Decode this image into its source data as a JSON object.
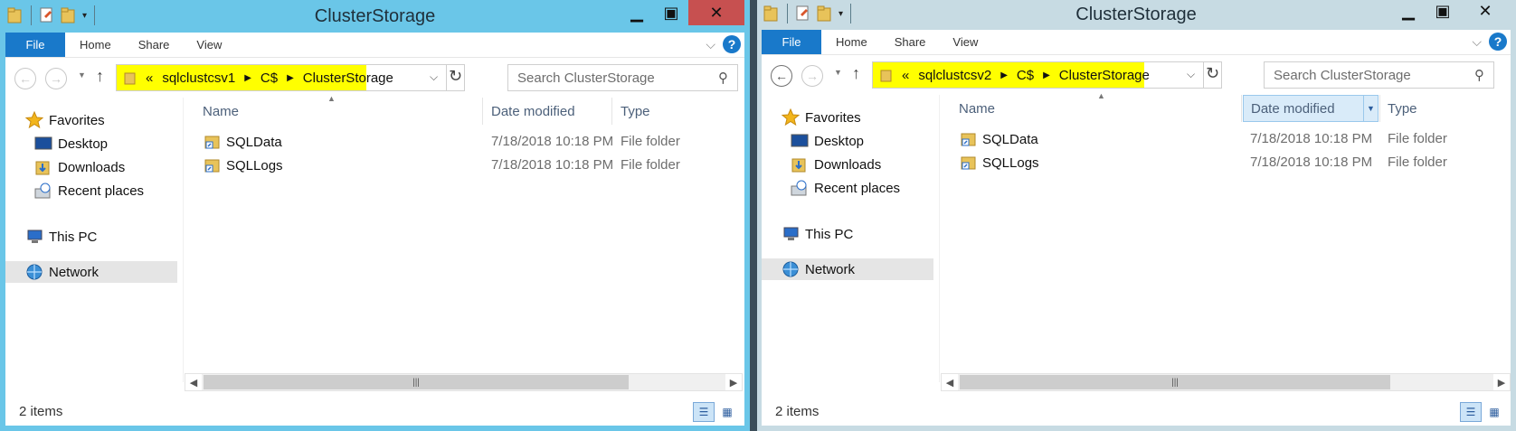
{
  "windows": [
    {
      "title": "ClusterStorage",
      "ribbon": {
        "file": "File",
        "tabs": [
          "Home",
          "Share",
          "View"
        ]
      },
      "address": {
        "overflow": "«",
        "crumbs": [
          "sqlclustcsv1",
          "C$",
          "ClusterStorage"
        ]
      },
      "search": {
        "placeholder": "Search ClusterStorage"
      },
      "nav": {
        "favorites": "Favorites",
        "desktop": "Desktop",
        "downloads": "Downloads",
        "recent": "Recent places",
        "thispc": "This PC",
        "network": "Network"
      },
      "columns": {
        "name": "Name",
        "date": "Date modified",
        "type": "Type"
      },
      "files": [
        {
          "name": "SQLData",
          "date": "7/18/2018 10:18 PM",
          "type": "File folder"
        },
        {
          "name": "SQLLogs",
          "date": "7/18/2018 10:18 PM",
          "type": "File folder"
        }
      ],
      "status": {
        "count": "2 items"
      }
    },
    {
      "title": "ClusterStorage",
      "ribbon": {
        "file": "File",
        "tabs": [
          "Home",
          "Share",
          "View"
        ]
      },
      "address": {
        "overflow": "«",
        "crumbs": [
          "sqlclustcsv2",
          "C$",
          "ClusterStorage"
        ]
      },
      "search": {
        "placeholder": "Search ClusterStorage"
      },
      "nav": {
        "favorites": "Favorites",
        "desktop": "Desktop",
        "downloads": "Downloads",
        "recent": "Recent places",
        "thispc": "This PC",
        "network": "Network"
      },
      "columns": {
        "name": "Name",
        "date": "Date modified",
        "type": "Type"
      },
      "files": [
        {
          "name": "SQLData",
          "date": "7/18/2018 10:18 PM",
          "type": "File folder"
        },
        {
          "name": "SQLLogs",
          "date": "7/18/2018 10:18 PM",
          "type": "File folder"
        }
      ],
      "status": {
        "count": "2 items"
      }
    }
  ],
  "colors": {
    "active_frame": "#6ac6e8",
    "inactive_frame": "#c7dbe3",
    "highlight": "#ffff00",
    "file_tab": "#1979ca",
    "close_button": "#c75050"
  }
}
